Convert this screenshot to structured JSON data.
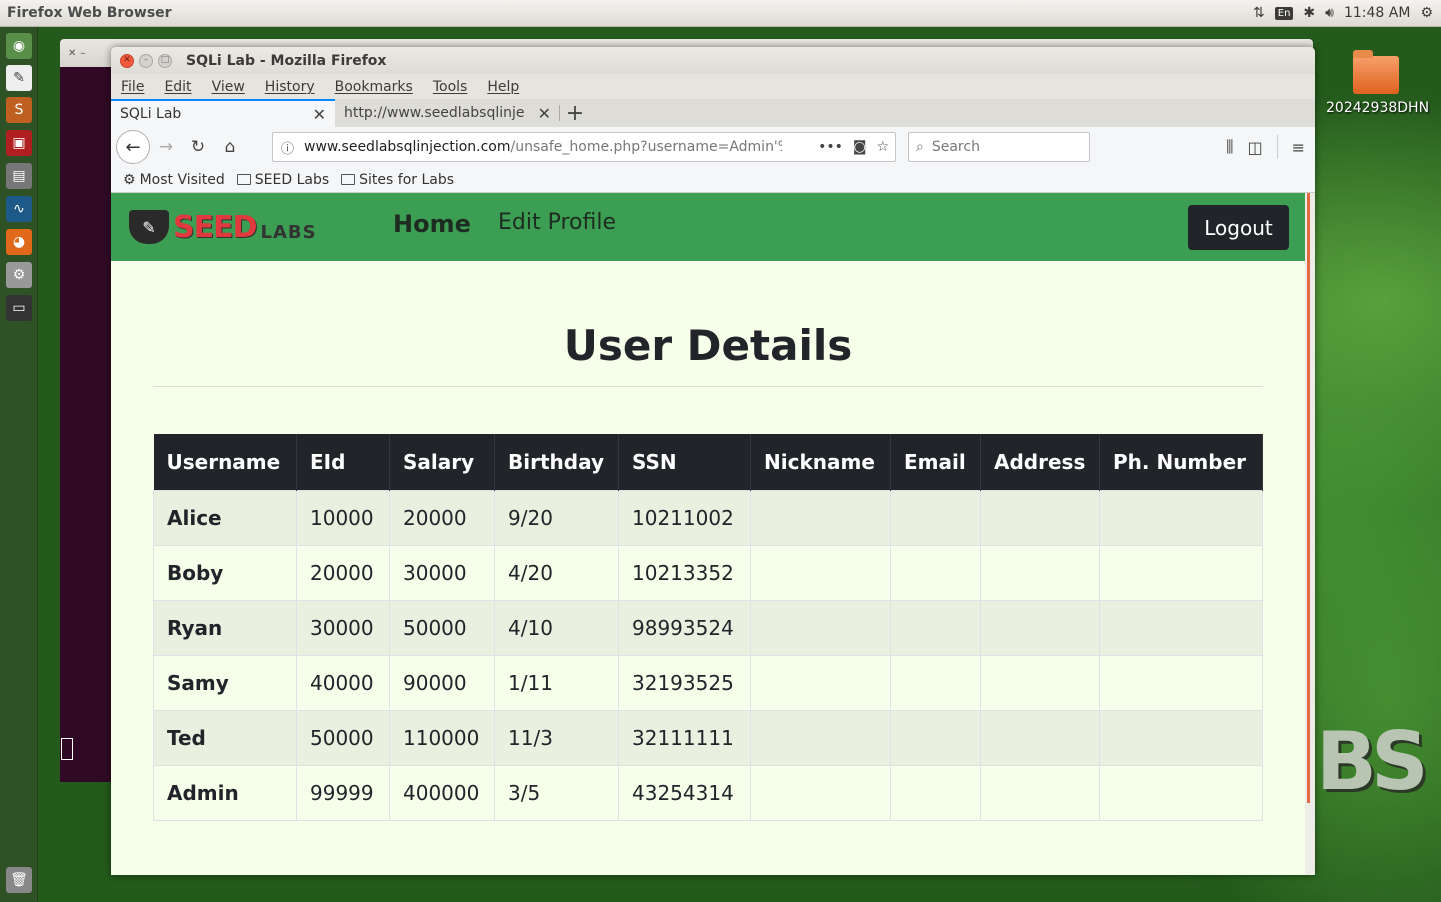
{
  "top_panel": {
    "app_title": "Firefox Web Browser",
    "lang": "En",
    "time": "11:48 AM"
  },
  "desktop": {
    "folder_label": "20242938DHN",
    "wall_text": "BS"
  },
  "window": {
    "title": "SQLi Lab - Mozilla Firefox"
  },
  "menu": [
    "File",
    "Edit",
    "View",
    "History",
    "Bookmarks",
    "Tools",
    "Help"
  ],
  "tabs": [
    {
      "label": "SQLi Lab"
    },
    {
      "label": "http://www.seedlabsqlinje"
    }
  ],
  "urlbar": {
    "host": "www.seedlabsqlinjection.com",
    "path": "/unsafe_home.php?username=Admin'%"
  },
  "search": {
    "placeholder": "Search"
  },
  "bookmarks": [
    "Most Visited",
    "SEED Labs",
    "Sites for Labs"
  ],
  "site": {
    "logo_seed": "SEED",
    "logo_labs": "LABS",
    "nav_home": "Home",
    "nav_edit": "Edit Profile",
    "logout": "Logout",
    "page_title": "User Details"
  },
  "table": {
    "headers": [
      "Username",
      "EId",
      "Salary",
      "Birthday",
      "SSN",
      "Nickname",
      "Email",
      "Address",
      "Ph. Number"
    ],
    "rows": [
      [
        "Alice",
        "10000",
        "20000",
        "9/20",
        "10211002",
        "",
        "",
        "",
        ""
      ],
      [
        "Boby",
        "20000",
        "30000",
        "4/20",
        "10213352",
        "",
        "",
        "",
        ""
      ],
      [
        "Ryan",
        "30000",
        "50000",
        "4/10",
        "98993524",
        "",
        "",
        "",
        ""
      ],
      [
        "Samy",
        "40000",
        "90000",
        "1/11",
        "32193525",
        "",
        "",
        "",
        ""
      ],
      [
        "Ted",
        "50000",
        "110000",
        "11/3",
        "32111111",
        "",
        "",
        "",
        ""
      ],
      [
        "Admin",
        "99999",
        "400000",
        "3/5",
        "43254314",
        "",
        "",
        "",
        ""
      ]
    ]
  },
  "colors": {
    "nav_green": "#3c9e52",
    "page_bg": "#f5ffea",
    "header_dark": "#212529",
    "tab_accent": "#0a84ff"
  }
}
